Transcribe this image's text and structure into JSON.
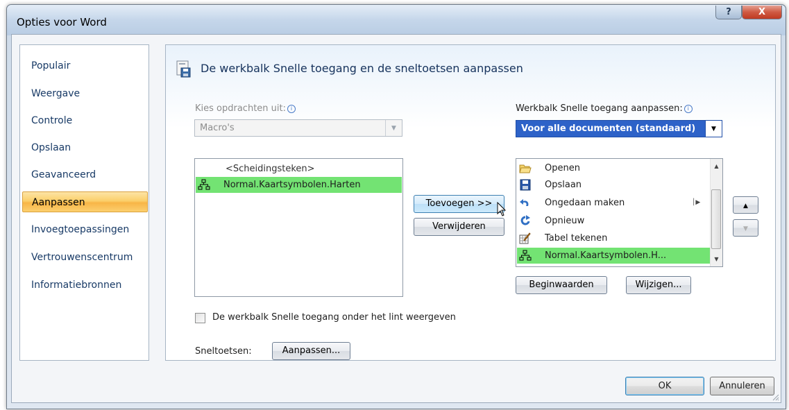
{
  "window": {
    "title": "Opties voor Word",
    "help_label": "?",
    "close_label": "X"
  },
  "sidebar": {
    "items": [
      {
        "label": "Populair"
      },
      {
        "label": "Weergave"
      },
      {
        "label": "Controle"
      },
      {
        "label": "Opslaan"
      },
      {
        "label": "Geavanceerd"
      },
      {
        "label": "Aanpassen"
      },
      {
        "label": "Invoegtoepassingen"
      },
      {
        "label": "Vertrouwenscentrum"
      },
      {
        "label": "Informatiebronnen"
      }
    ],
    "active": "Aanpassen"
  },
  "header": {
    "title": "De werkbalk Snelle toegang en de sneltoetsen aanpassen"
  },
  "commands": {
    "label": "Kies opdrachten uit:",
    "value": "Macro's",
    "items": [
      "<Scheidingsteken>",
      "Normal.Kaartsymbolen.Harten"
    ]
  },
  "qat": {
    "label": "Werkbalk Snelle toegang aanpassen:",
    "value": "Voor alle documenten (standaard)",
    "items": [
      "Openen",
      "Opslaan",
      "Ongedaan maken",
      "Opnieuw",
      "Tabel tekenen",
      "Normal.Kaartsymbolen.H..."
    ]
  },
  "buttons": {
    "add": "Toevoegen >>",
    "remove": "Verwijderen",
    "reset": "Beginwaarden",
    "modify": "Wijzigen...",
    "customize": "Aanpassen...",
    "ok": "OK",
    "cancel": "Annuleren",
    "up": "▲",
    "down": "▼"
  },
  "checkbox": {
    "label": "De werkbalk Snelle toegang onder het lint weergeven",
    "checked": false
  },
  "shortcuts": {
    "label": "Sneltoetsen:"
  },
  "colors": {
    "accent": "#2d62c8",
    "selection": "#73e373",
    "active_tab": "#fbcf6a"
  }
}
